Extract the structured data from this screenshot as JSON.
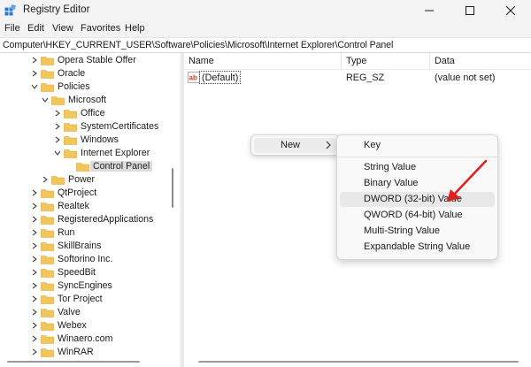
{
  "window": {
    "title": "Registry Editor",
    "accent_color": "#1f6fd0"
  },
  "menubar": {
    "items": [
      "File",
      "Edit",
      "View",
      "Favorites",
      "Help"
    ]
  },
  "address": {
    "path": "Computer\\HKEY_CURRENT_USER\\Software\\Policies\\Microsoft\\Internet Explorer\\Control Panel"
  },
  "tree": {
    "folder_color": "#f2c65a",
    "items": [
      {
        "label": "Opera Stable Offer",
        "state": "collapsed"
      },
      {
        "label": "Oracle",
        "state": "collapsed"
      },
      {
        "label": "Policies",
        "state": "expanded"
      },
      {
        "label": "Microsoft",
        "state": "expanded"
      },
      {
        "label": "Office",
        "state": "collapsed"
      },
      {
        "label": "SystemCertificates",
        "state": "collapsed"
      },
      {
        "label": "Windows",
        "state": "collapsed"
      },
      {
        "label": "Internet Explorer",
        "state": "expanded"
      },
      {
        "label": "Control Panel",
        "state": "leaf-selected"
      },
      {
        "label": "Power",
        "state": "collapsed"
      },
      {
        "label": "QtProject",
        "state": "collapsed"
      },
      {
        "label": "Realtek",
        "state": "collapsed"
      },
      {
        "label": "RegisteredApplications",
        "state": "collapsed"
      },
      {
        "label": "Run",
        "state": "collapsed"
      },
      {
        "label": "SkillBrains",
        "state": "collapsed"
      },
      {
        "label": "Softorino Inc.",
        "state": "collapsed"
      },
      {
        "label": "SpeedBit",
        "state": "collapsed"
      },
      {
        "label": "SyncEngines",
        "state": "collapsed"
      },
      {
        "label": "Tor Project",
        "state": "collapsed"
      },
      {
        "label": "Valve",
        "state": "collapsed"
      },
      {
        "label": "Webex",
        "state": "collapsed"
      },
      {
        "label": "Winaero.com",
        "state": "collapsed"
      },
      {
        "label": "WinRAR",
        "state": "collapsed"
      }
    ]
  },
  "list": {
    "columns": [
      "Name",
      "Type",
      "Data"
    ],
    "rows": [
      {
        "name": "(Default)",
        "type": "REG_SZ",
        "data": "(value not set)",
        "icon": "string-value-icon"
      }
    ]
  },
  "context_menu": {
    "new_label": "New",
    "submenu": {
      "key_label": "Key",
      "values": [
        "String Value",
        "Binary Value",
        "DWORD (32-bit) Value",
        "QWORD (64-bit) Value",
        "Multi-String Value",
        "Expandable String Value"
      ],
      "highlighted": "DWORD (32-bit) Value"
    }
  },
  "annotation": {
    "arrow_color": "#e02020"
  }
}
